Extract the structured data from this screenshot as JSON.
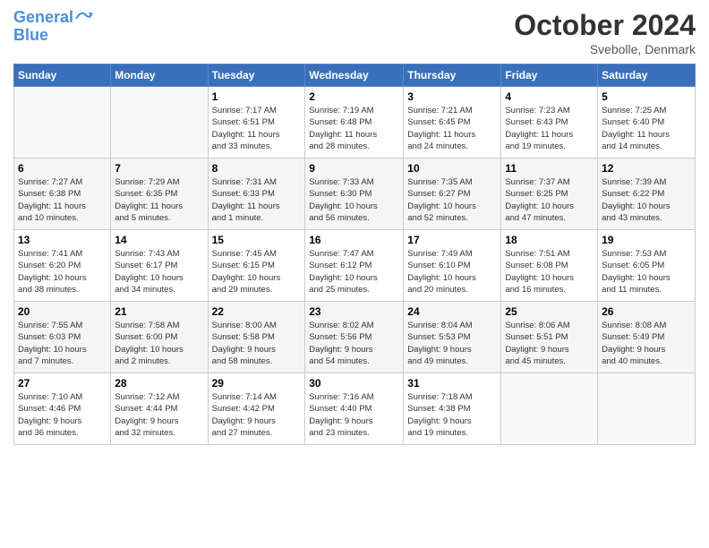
{
  "header": {
    "logo_line1": "General",
    "logo_line2": "Blue",
    "month": "October 2024",
    "location": "Svebolle, Denmark"
  },
  "weekdays": [
    "Sunday",
    "Monday",
    "Tuesday",
    "Wednesday",
    "Thursday",
    "Friday",
    "Saturday"
  ],
  "weeks": [
    [
      {
        "day": "",
        "info": ""
      },
      {
        "day": "",
        "info": ""
      },
      {
        "day": "1",
        "info": "Sunrise: 7:17 AM\nSunset: 6:51 PM\nDaylight: 11 hours\nand 33 minutes."
      },
      {
        "day": "2",
        "info": "Sunrise: 7:19 AM\nSunset: 6:48 PM\nDaylight: 11 hours\nand 28 minutes."
      },
      {
        "day": "3",
        "info": "Sunrise: 7:21 AM\nSunset: 6:45 PM\nDaylight: 11 hours\nand 24 minutes."
      },
      {
        "day": "4",
        "info": "Sunrise: 7:23 AM\nSunset: 6:43 PM\nDaylight: 11 hours\nand 19 minutes."
      },
      {
        "day": "5",
        "info": "Sunrise: 7:25 AM\nSunset: 6:40 PM\nDaylight: 11 hours\nand 14 minutes."
      }
    ],
    [
      {
        "day": "6",
        "info": "Sunrise: 7:27 AM\nSunset: 6:38 PM\nDaylight: 11 hours\nand 10 minutes."
      },
      {
        "day": "7",
        "info": "Sunrise: 7:29 AM\nSunset: 6:35 PM\nDaylight: 11 hours\nand 5 minutes."
      },
      {
        "day": "8",
        "info": "Sunrise: 7:31 AM\nSunset: 6:33 PM\nDaylight: 11 hours\nand 1 minute."
      },
      {
        "day": "9",
        "info": "Sunrise: 7:33 AM\nSunset: 6:30 PM\nDaylight: 10 hours\nand 56 minutes."
      },
      {
        "day": "10",
        "info": "Sunrise: 7:35 AM\nSunset: 6:27 PM\nDaylight: 10 hours\nand 52 minutes."
      },
      {
        "day": "11",
        "info": "Sunrise: 7:37 AM\nSunset: 6:25 PM\nDaylight: 10 hours\nand 47 minutes."
      },
      {
        "day": "12",
        "info": "Sunrise: 7:39 AM\nSunset: 6:22 PM\nDaylight: 10 hours\nand 43 minutes."
      }
    ],
    [
      {
        "day": "13",
        "info": "Sunrise: 7:41 AM\nSunset: 6:20 PM\nDaylight: 10 hours\nand 38 minutes."
      },
      {
        "day": "14",
        "info": "Sunrise: 7:43 AM\nSunset: 6:17 PM\nDaylight: 10 hours\nand 34 minutes."
      },
      {
        "day": "15",
        "info": "Sunrise: 7:45 AM\nSunset: 6:15 PM\nDaylight: 10 hours\nand 29 minutes."
      },
      {
        "day": "16",
        "info": "Sunrise: 7:47 AM\nSunset: 6:12 PM\nDaylight: 10 hours\nand 25 minutes."
      },
      {
        "day": "17",
        "info": "Sunrise: 7:49 AM\nSunset: 6:10 PM\nDaylight: 10 hours\nand 20 minutes."
      },
      {
        "day": "18",
        "info": "Sunrise: 7:51 AM\nSunset: 6:08 PM\nDaylight: 10 hours\nand 16 minutes."
      },
      {
        "day": "19",
        "info": "Sunrise: 7:53 AM\nSunset: 6:05 PM\nDaylight: 10 hours\nand 11 minutes."
      }
    ],
    [
      {
        "day": "20",
        "info": "Sunrise: 7:55 AM\nSunset: 6:03 PM\nDaylight: 10 hours\nand 7 minutes."
      },
      {
        "day": "21",
        "info": "Sunrise: 7:58 AM\nSunset: 6:00 PM\nDaylight: 10 hours\nand 2 minutes."
      },
      {
        "day": "22",
        "info": "Sunrise: 8:00 AM\nSunset: 5:58 PM\nDaylight: 9 hours\nand 58 minutes."
      },
      {
        "day": "23",
        "info": "Sunrise: 8:02 AM\nSunset: 5:56 PM\nDaylight: 9 hours\nand 54 minutes."
      },
      {
        "day": "24",
        "info": "Sunrise: 8:04 AM\nSunset: 5:53 PM\nDaylight: 9 hours\nand 49 minutes."
      },
      {
        "day": "25",
        "info": "Sunrise: 8:06 AM\nSunset: 5:51 PM\nDaylight: 9 hours\nand 45 minutes."
      },
      {
        "day": "26",
        "info": "Sunrise: 8:08 AM\nSunset: 5:49 PM\nDaylight: 9 hours\nand 40 minutes."
      }
    ],
    [
      {
        "day": "27",
        "info": "Sunrise: 7:10 AM\nSunset: 4:46 PM\nDaylight: 9 hours\nand 36 minutes."
      },
      {
        "day": "28",
        "info": "Sunrise: 7:12 AM\nSunset: 4:44 PM\nDaylight: 9 hours\nand 32 minutes."
      },
      {
        "day": "29",
        "info": "Sunrise: 7:14 AM\nSunset: 4:42 PM\nDaylight: 9 hours\nand 27 minutes."
      },
      {
        "day": "30",
        "info": "Sunrise: 7:16 AM\nSunset: 4:40 PM\nDaylight: 9 hours\nand 23 minutes."
      },
      {
        "day": "31",
        "info": "Sunrise: 7:18 AM\nSunset: 4:38 PM\nDaylight: 9 hours\nand 19 minutes."
      },
      {
        "day": "",
        "info": ""
      },
      {
        "day": "",
        "info": ""
      }
    ]
  ]
}
